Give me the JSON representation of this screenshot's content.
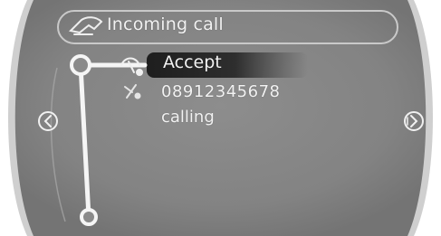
{
  "header": {
    "title": "Incoming call",
    "icon": "phone-icon"
  },
  "menu": {
    "items": [
      {
        "label": "Accept",
        "icon": "accept-call-icon",
        "selected": true
      }
    ]
  },
  "caller": {
    "icon": "phone-number-icon",
    "number": "08912345678",
    "status": "calling"
  },
  "navigation": {
    "left_icon": "arrow-left-icon",
    "right_icon": "arrow-right-icon"
  },
  "colors": {
    "background": "#8a8a8a",
    "bezel": "#d9d9d9",
    "highlight": "#2a2a2a",
    "text": "#f2f2f2"
  }
}
